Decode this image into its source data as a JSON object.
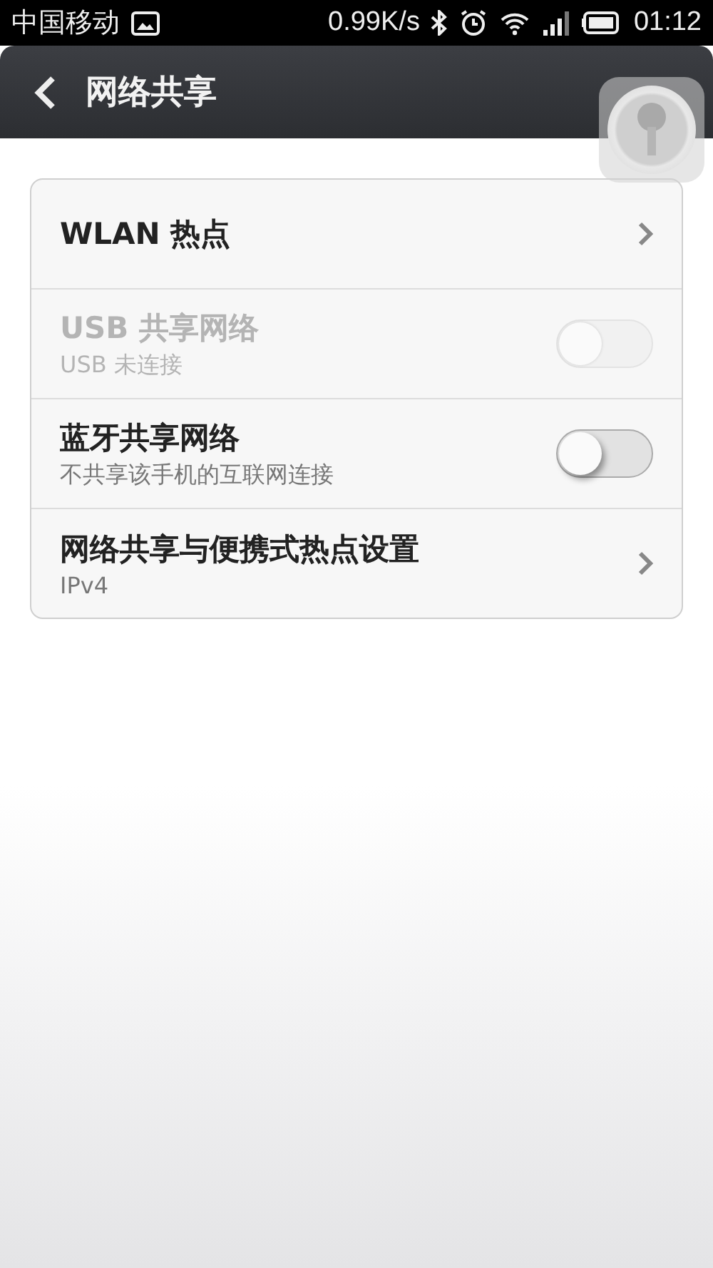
{
  "status_bar": {
    "carrier": "中国移动",
    "speed": "0.99K/s",
    "time": "01:12"
  },
  "header": {
    "title": "网络共享"
  },
  "rows": [
    {
      "kind": "link",
      "title": "WLAN 热点",
      "disabled": false
    },
    {
      "kind": "toggle",
      "title": "USB 共享网络",
      "subtitle": "USB 未连接",
      "disabled": true,
      "on": false
    },
    {
      "kind": "toggle",
      "title": "蓝牙共享网络",
      "subtitle": "不共享该手机的互联网连接",
      "disabled": false,
      "on": false
    },
    {
      "kind": "link",
      "title": "网络共享与便携式热点设置",
      "subtitle": "IPv4",
      "disabled": false
    }
  ]
}
